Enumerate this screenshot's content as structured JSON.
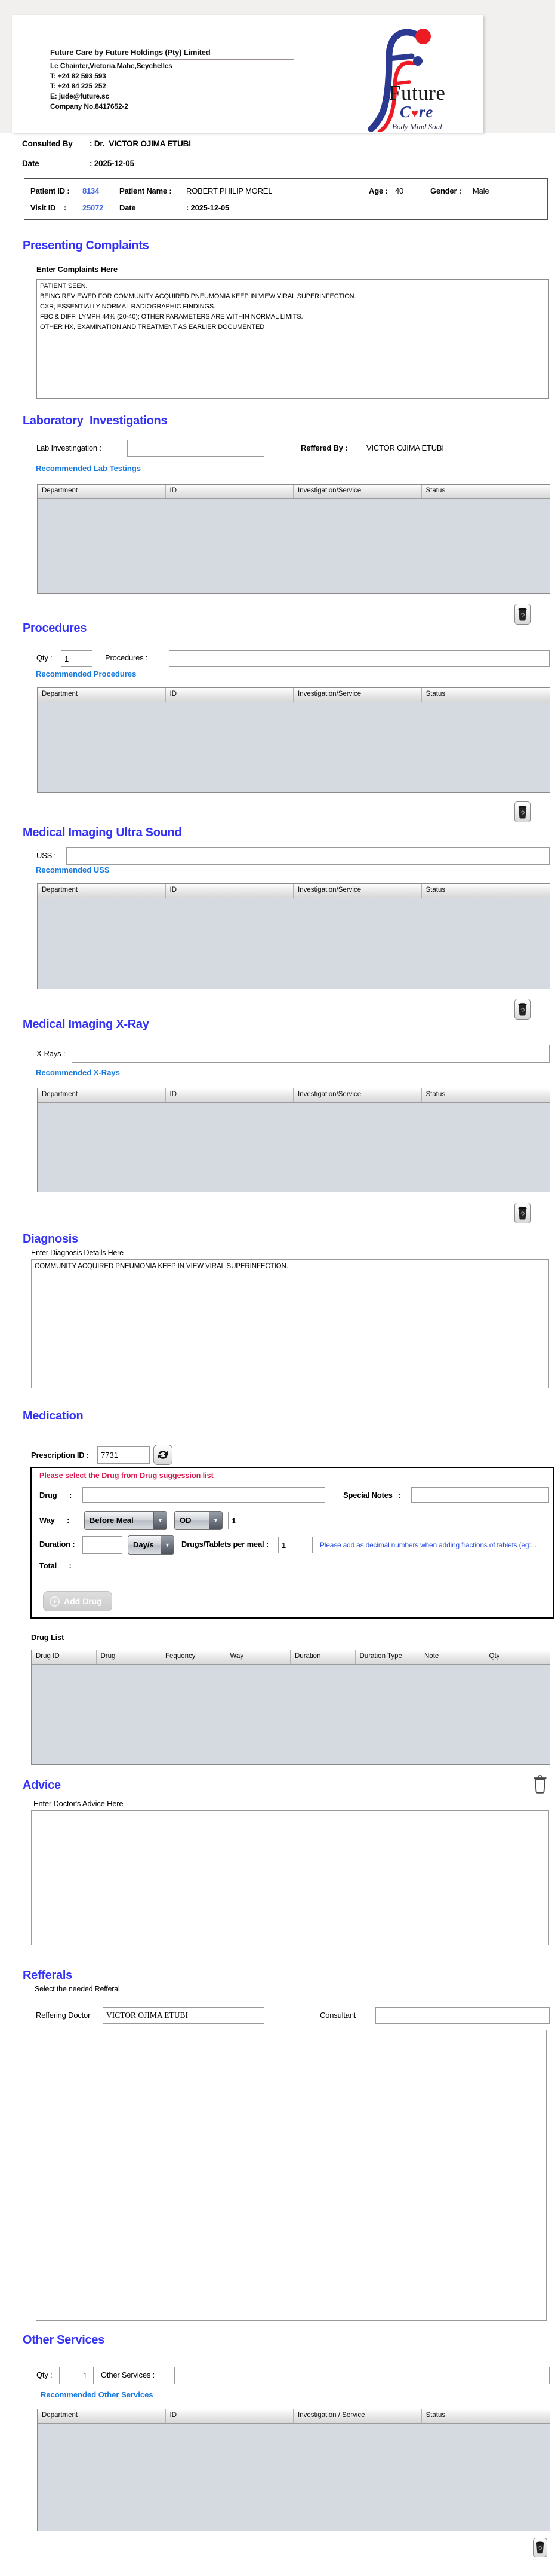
{
  "header": {
    "company": "Future Care by Future Holdings (Pty) Limited",
    "address": "Le Chainter,Victoria,Mahe,Seychelles",
    "phone1": "T: +24  82 593 593",
    "phone2": "T: +24  84 225 252",
    "email": "E: jude@future.sc",
    "company_no": "Company No.8417652-2",
    "logo": {
      "word1": "Future",
      "word2_c": "C",
      "word2_re": "re",
      "heart": "♥",
      "tagline": "Body Mind Soul",
      "blue": "#2b3990",
      "red": "#ed1c24"
    }
  },
  "consult": {
    "label": "Consulted By",
    "value": ": Dr.  VICTOR OJIMA ETUBI",
    "date_label": "Date",
    "date_value": ": 2025-12-05"
  },
  "patient": {
    "id_label": "Patient ID :",
    "id": "8134",
    "name_label": "Patient Name :",
    "name": "ROBERT PHILIP MOREL",
    "age_label": "Age :",
    "age": "40",
    "gender_label": "Gender :",
    "gender": "Male",
    "visit_label": "Visit ID    :",
    "visit_id": "25072",
    "date_label": "Date",
    "date_value": ": 2025-12-05"
  },
  "complaints": {
    "heading": "Presenting Complaints",
    "label": "Enter Complaints Here",
    "text": "PATIENT SEEN.\nBEING REVIEWED FOR COMMUNITY ACQUIRED PNEUMONIA KEEP IN VIEW VIRAL SUPERINFECTION.\nCXR; ESSENTIALLY NORMAL RADIOGRAPHIC FINDINGS.\nFBC & DIFF; LYMPH 44% (20-40); OTHER PARAMETERS ARE WITHIN NORMAL LIMITS.\nOTHER HX, EXAMINATION AND TREATMENT AS EARLIER DOCUMENTED"
  },
  "lab": {
    "heading": "Laboratory  Investigations",
    "input_label": "Lab Investingation :",
    "referred_label": "Reffered By :",
    "referred_by": "VICTOR OJIMA ETUBI",
    "link": "Recommended Lab Testings",
    "headers": [
      "Department",
      "ID",
      "Investigation/Service",
      "Status"
    ]
  },
  "procedures": {
    "heading": "Procedures",
    "qty_label": "Qty :",
    "qty": "1",
    "input_label": "Procedures :",
    "link": "Recommended Procedures",
    "headers": [
      "Department",
      "ID",
      "Investigation/Service",
      "Status"
    ]
  },
  "uss": {
    "heading": "Medical Imaging Ultra Sound",
    "input_label": "USS :",
    "link": "Recommended USS",
    "headers": [
      "Department",
      "ID",
      "Investigation/Service",
      "Status"
    ]
  },
  "xray": {
    "heading": "Medical Imaging X-Ray",
    "input_label": "X-Rays :",
    "link": "Recommended X-Rays",
    "headers": [
      "Department",
      "ID",
      "Investigation/Service",
      "Status"
    ]
  },
  "diagnosis": {
    "heading": "Diagnosis",
    "label": "Enter Diagnosis Details Here",
    "text": "COMMUNITY ACQUIRED PNEUMONIA KEEP IN VIEW VIRAL SUPERINFECTION."
  },
  "medication": {
    "heading": "Medication",
    "prescription_label": "Prescription ID :",
    "prescription_id": "7731",
    "notice": "Please select the Drug from Drug suggession list",
    "drug_label": "Drug      :",
    "special_notes_label": "Special Notes   :",
    "way_label": "Way      :",
    "meal_option": "Before Meal",
    "freq_option": "OD",
    "freq_qty": "1",
    "duration_label": "Duration :",
    "duration_value": "",
    "duration_unit": "Day/s",
    "per_meal_label": "Drugs/Tablets per meal :",
    "per_meal_value": "1",
    "hint": "Please add as decimal numbers when adding fractions of tablets (eg:...",
    "total_label": "Total      :",
    "add_drug_label": "Add Drug"
  },
  "druglist": {
    "label": "Drug List",
    "headers": [
      "Drug ID",
      "Drug",
      "Fequency",
      "Way",
      "Duration",
      "Duration Type",
      "Note",
      "Qty"
    ]
  },
  "advice": {
    "heading": "Advice",
    "label": "Enter Doctor's Advice Here",
    "text": ""
  },
  "referrals": {
    "heading": "Refferals",
    "sub_label": "Select the needed Refferal",
    "doctor_label": "Reffering Doctor",
    "doctor": "VICTOR OJIMA ETUBI",
    "consultant_label": "Consultant",
    "consultant": ""
  },
  "other": {
    "heading": "Other Services",
    "qty_label": "Qty :",
    "qty": "1",
    "input_label": "Other Services :",
    "link": "Recommended Other Services",
    "headers": [
      "Department",
      "ID",
      "Investigation / Service",
      "Status"
    ]
  }
}
